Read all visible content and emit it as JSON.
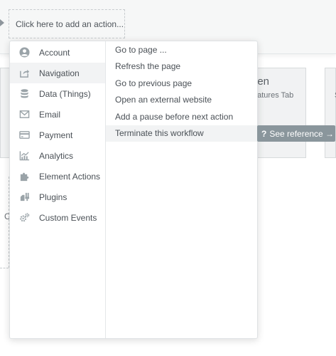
{
  "workflow": {
    "add_action_label": "Click here to add an action...",
    "background_card": {
      "title": "hen",
      "subtitle": "eatures Tab"
    },
    "right_card_subtitle": "S",
    "side_letter": "C"
  },
  "menu": {
    "categories": [
      {
        "label": "Account",
        "icon": "account-icon"
      },
      {
        "label": "Navigation",
        "icon": "navigation-icon"
      },
      {
        "label": "Data (Things)",
        "icon": "database-icon"
      },
      {
        "label": "Email",
        "icon": "email-icon"
      },
      {
        "label": "Payment",
        "icon": "credit-card-icon"
      },
      {
        "label": "Analytics",
        "icon": "analytics-icon"
      },
      {
        "label": "Element Actions",
        "icon": "puzzle-icon"
      },
      {
        "label": "Plugins",
        "icon": "plugin-icon"
      },
      {
        "label": "Custom Events",
        "icon": "gears-icon"
      }
    ],
    "active_category": "Navigation",
    "actions": [
      "Go to page ...",
      "Refresh the page",
      "Go to previous page",
      "Open an external website",
      "Add a pause before next action",
      "Terminate this workflow"
    ],
    "hovered_action": "Terminate this workflow"
  },
  "reference_button": {
    "icon": "?",
    "label": "See reference →"
  },
  "colors": {
    "icon_gray": "#9aa3a8",
    "reference_bg": "#8a969c",
    "active_row_bg": "#f2f3f4"
  }
}
